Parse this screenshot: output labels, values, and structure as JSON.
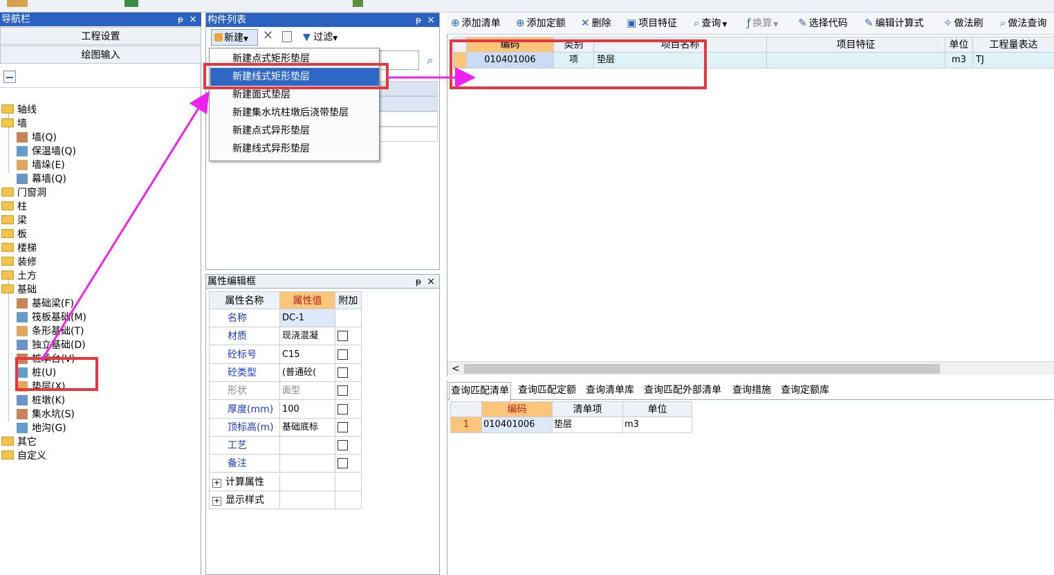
{
  "nav_panel": {
    "title": "导航栏",
    "pin_glyph": "ᵽ",
    "close_glyph": "×",
    "buttons": [
      "工程设置",
      "绘图输入"
    ],
    "tree": [
      {
        "label": "轴线",
        "type": "folder"
      },
      {
        "label": "墙",
        "type": "folder"
      },
      {
        "label": "墙(Q)",
        "type": "leaf"
      },
      {
        "label": "保温墙(Q)",
        "type": "leaf"
      },
      {
        "label": "墙垛(E)",
        "type": "leaf"
      },
      {
        "label": "幕墙(Q)",
        "type": "leaf"
      },
      {
        "label": "门窗洞",
        "type": "folder"
      },
      {
        "label": "柱",
        "type": "folder"
      },
      {
        "label": "梁",
        "type": "folder"
      },
      {
        "label": "板",
        "type": "folder"
      },
      {
        "label": "楼梯",
        "type": "folder"
      },
      {
        "label": "装修",
        "type": "folder"
      },
      {
        "label": "土方",
        "type": "folder"
      },
      {
        "label": "基础",
        "type": "folder"
      },
      {
        "label": "基础梁(F)",
        "type": "leaf"
      },
      {
        "label": "筏板基础(M)",
        "type": "leaf"
      },
      {
        "label": "条形基础(T)",
        "type": "leaf"
      },
      {
        "label": "独立基础(D)",
        "type": "leaf"
      },
      {
        "label": "桩承台(V)",
        "type": "leaf"
      },
      {
        "label": "桩(U)",
        "type": "leaf"
      },
      {
        "label": "垫层(X)",
        "type": "leaf"
      },
      {
        "label": "桩墩(K)",
        "type": "leaf"
      },
      {
        "label": "集水坑(S)",
        "type": "leaf"
      },
      {
        "label": "地沟(G)",
        "type": "leaf"
      },
      {
        "label": "其它",
        "type": "folder"
      },
      {
        "label": "自定义",
        "type": "folder"
      }
    ]
  },
  "component_panel": {
    "title": "构件列表",
    "new_label": "新建",
    "filter_label": "过滤",
    "menu": [
      "新建点式矩形垫层",
      "新建线式矩形垫层",
      "新建面式垫层",
      "新建集水坑柱墩后浇带垫层",
      "新建点式异形垫层",
      "新建线式异形垫层"
    ]
  },
  "property_panel": {
    "title": "属性编辑框",
    "headers": [
      "属性名称",
      "属性值",
      "附加"
    ],
    "rows": [
      {
        "name": "名称",
        "value": "DC-1",
        "check": false
      },
      {
        "name": "材质",
        "value": "现浇混凝",
        "check": true
      },
      {
        "name": "砼标号",
        "value": "C15",
        "check": true
      },
      {
        "name": "砼类型",
        "value": "(普通砼(",
        "check": true
      },
      {
        "name": "形状",
        "value": "面型",
        "check": true
      },
      {
        "name": "厚度(mm)",
        "value": "100",
        "check": true
      },
      {
        "name": "顶标高(m)",
        "value": "基础底标",
        "check": true
      },
      {
        "name": "工艺",
        "value": "",
        "check": true
      },
      {
        "name": "备注",
        "value": "",
        "check": true
      },
      {
        "name": "计算属性",
        "value": "",
        "check": false
      },
      {
        "name": "显示样式",
        "value": "",
        "check": false
      }
    ]
  },
  "right_toolbar": [
    "添加清单",
    "添加定额",
    "删除",
    "项目特征",
    "查询",
    "换算",
    "选择代码",
    "编辑计算式",
    "做法刷",
    "做法查询"
  ],
  "main_grid": {
    "headers": [
      "编码",
      "类别",
      "项目名称",
      "项目特征",
      "单位",
      "工程量表达"
    ],
    "rows": [
      {
        "code": "010401006",
        "type": "项",
        "name": "垫层",
        "feature": "",
        "unit": "m3",
        "expr": "TJ"
      }
    ]
  },
  "bottom_tabs": [
    "查询匹配清单",
    "查询匹配定额",
    "查询清单库",
    "查询匹配外部清单",
    "查询措施",
    "查询定额库"
  ],
  "bottom_grid": {
    "headers": [
      "编码",
      "清单项",
      "单位"
    ],
    "rows": [
      {
        "index": "1",
        "code": "010401006",
        "item": "垫层",
        "unit": "m3"
      }
    ]
  }
}
